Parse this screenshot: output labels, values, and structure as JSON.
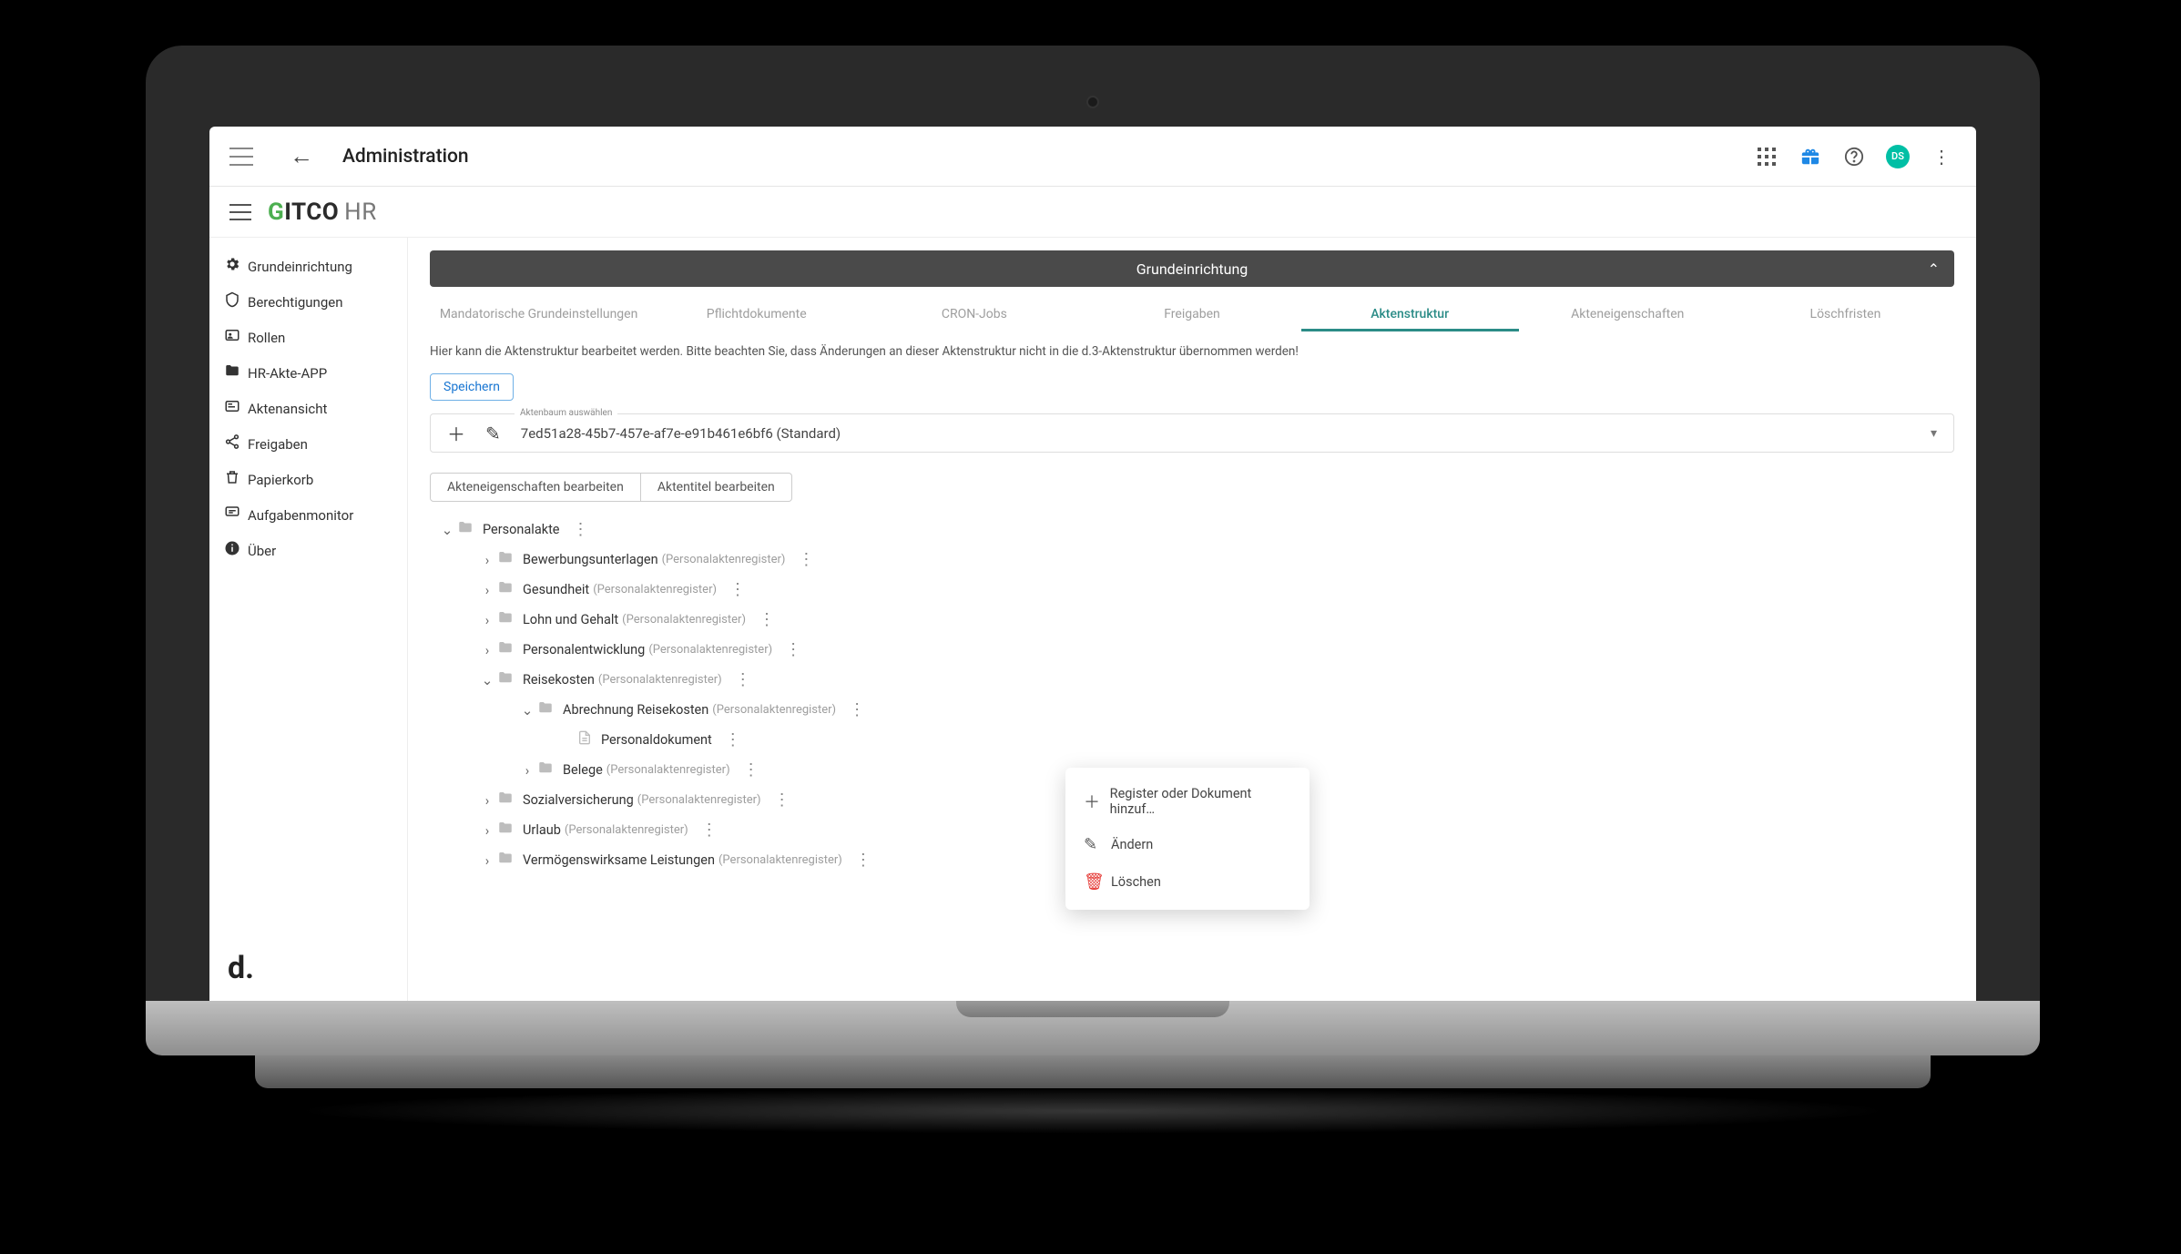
{
  "topbar": {
    "title": "Administration",
    "avatar": "DS"
  },
  "brand": {
    "g": "G",
    "rest": "ITCO",
    "hr": "HR"
  },
  "sidebar": {
    "items": [
      {
        "icon": "gear",
        "label": "Grundeinrichtung"
      },
      {
        "icon": "shield",
        "label": "Berechtigungen"
      },
      {
        "icon": "badge",
        "label": "Rollen"
      },
      {
        "icon": "folder",
        "label": "HR-Akte-APP"
      },
      {
        "icon": "card",
        "label": "Aktenansicht"
      },
      {
        "icon": "share",
        "label": "Freigaben"
      },
      {
        "icon": "trash",
        "label": "Papierkorb"
      },
      {
        "icon": "monitor",
        "label": "Aufgabenmonitor"
      },
      {
        "icon": "info",
        "label": "Über"
      }
    ]
  },
  "section": {
    "title": "Grundeinrichtung"
  },
  "tabs": [
    "Mandatorische Grundeinstellungen",
    "Pflichtdokumente",
    "CRON-Jobs",
    "Freigaben",
    "Aktenstruktur",
    "Akteneigenschaften",
    "Löschfristen"
  ],
  "active_tab_index": 4,
  "help_text": "Hier kann die Aktenstruktur bearbeitet werden. Bitte beachten Sie, dass Änderungen an dieser Aktenstruktur nicht in die d.3-Aktenstruktur übernommen werden!",
  "save_label": "Speichern",
  "selector": {
    "label": "Aktenbaum auswählen",
    "value": "7ed51a28-45b7-457e-af7e-e91b461e6bf6 (Standard)"
  },
  "chips": [
    "Akteneigenschaften bearbeiten",
    "Aktentitel bearbeiten"
  ],
  "type_label": "(Personalaktenregister)",
  "tree": {
    "root": "Personalakte",
    "c": [
      {
        "name": "Bewerbungsunterlagen"
      },
      {
        "name": "Gesundheit"
      },
      {
        "name": "Lohn und Gehalt"
      },
      {
        "name": "Personalentwicklung"
      },
      {
        "name": "Reisekosten",
        "open": true,
        "c": [
          {
            "name": "Abrechnung Reisekosten",
            "open": true,
            "c": [
              {
                "name": "Personaldokument",
                "doc": true
              }
            ]
          },
          {
            "name": "Belege"
          }
        ]
      },
      {
        "name": "Sozialversicherung"
      },
      {
        "name": "Urlaub"
      },
      {
        "name": "Vermögenswirksame Leistungen"
      }
    ]
  },
  "ctx": [
    {
      "icon": "＋",
      "label": "Register oder Dokument hinzuf…"
    },
    {
      "icon": "✎",
      "label": "Ändern"
    },
    {
      "icon": "🗑",
      "label": "Löschen",
      "red": true
    }
  ],
  "footer": "d."
}
